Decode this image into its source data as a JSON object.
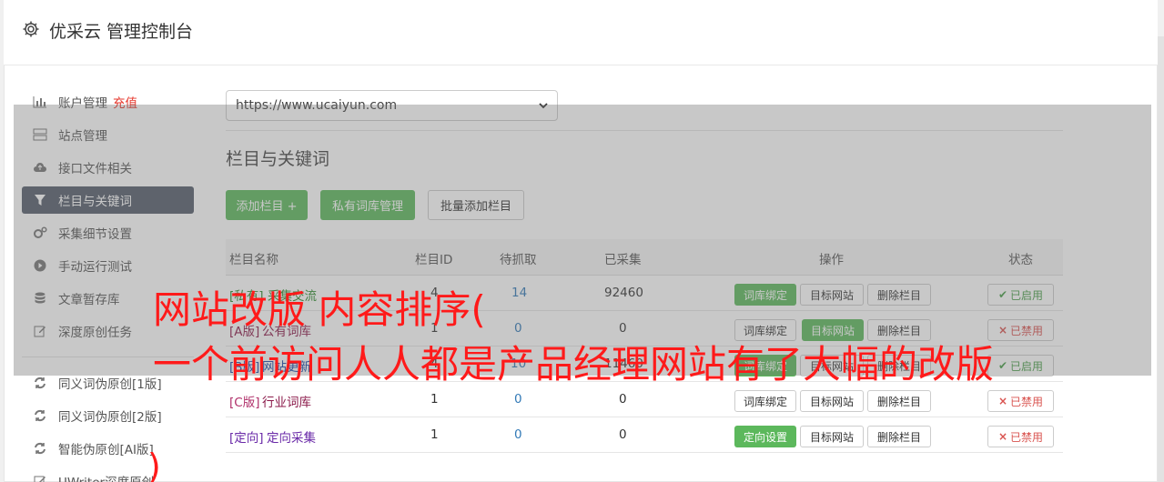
{
  "app": {
    "title": "优采云 管理控制台"
  },
  "sidebar": {
    "items": [
      {
        "label": "账户管理",
        "extra": "充值",
        "icon": "bar-chart-icon"
      },
      {
        "label": "站点管理",
        "icon": "server-icon"
      },
      {
        "label": "接口文件相关",
        "icon": "cloud-upload-icon"
      },
      {
        "label": "栏目与关键词",
        "icon": "filter-icon",
        "active": true
      },
      {
        "label": "采集细节设置",
        "icon": "cogs-icon"
      },
      {
        "label": "手动运行测试",
        "icon": "play-circle-icon"
      },
      {
        "label": "文章暂存库",
        "icon": "database-icon"
      },
      {
        "label": "深度原创任务",
        "icon": "edit-icon"
      },
      {
        "label": "同义词伪原创[1版]",
        "icon": "refresh-icon"
      },
      {
        "label": "同义词伪原创[2版]",
        "icon": "refresh-icon"
      },
      {
        "label": "智能伪原创[AI版]",
        "icon": "refresh-icon"
      },
      {
        "label": "UWriter深度原创",
        "icon": "edit-icon"
      }
    ]
  },
  "site_select": {
    "value": "https://www.ucaiyun.com"
  },
  "section": {
    "title": "栏目与关键词"
  },
  "toolbar": {
    "add_label": "添加栏目 +",
    "lexicon_label": "私有词库管理",
    "batch_label": "批量添加栏目"
  },
  "table": {
    "headers": {
      "name": "栏目名称",
      "id": "栏目ID",
      "pending": "待抓取",
      "collected": "已采集",
      "ops": "操作",
      "status": "状态"
    },
    "rows": [
      {
        "tag": "[私有]",
        "name": "采集交流",
        "id": "4",
        "pending": "14",
        "collected": "92460",
        "op1": "词库绑定",
        "op2": "目标网站",
        "op3": "删除栏目",
        "status": "已启用",
        "enabled": true
      },
      {
        "tag": "[A版]",
        "name": "公有词库",
        "id": "1",
        "pending": "0",
        "collected": "0",
        "op1": "词库绑定",
        "op2": "目标网站",
        "op3": "删除栏目",
        "status": "已禁用",
        "enabled": false
      },
      {
        "tag": "[B版]",
        "name": "网站更新",
        "id": "4",
        "pending": "10",
        "collected": "11460",
        "op1": "词库绑定",
        "op2": "目标网站",
        "op3": "删除栏目",
        "status": "已启用",
        "enabled": true
      },
      {
        "tag": "[C版]",
        "name": "行业词库",
        "id": "1",
        "pending": "0",
        "collected": "0",
        "op1": "词库绑定",
        "op2": "目标网站",
        "op3": "删除栏目",
        "status": "已禁用",
        "enabled": false
      },
      {
        "tag": "[定向]",
        "name": "定向采集",
        "id": "1",
        "pending": "0",
        "collected": "0",
        "op1": "定向设置",
        "op2": "目标网站",
        "op3": "删除栏目",
        "status": "已禁用",
        "enabled": false
      }
    ]
  },
  "watermark": {
    "line1": "网站改版 内容排序(",
    "line2": "一个前访问人人都是产品经理网站有了大幅的改版",
    "line3": ")"
  },
  "colors": {
    "green": "#5cb85c",
    "sidebar_active": "#555d6b",
    "danger": "#d9534f",
    "watermark": "#ff1a1a"
  }
}
